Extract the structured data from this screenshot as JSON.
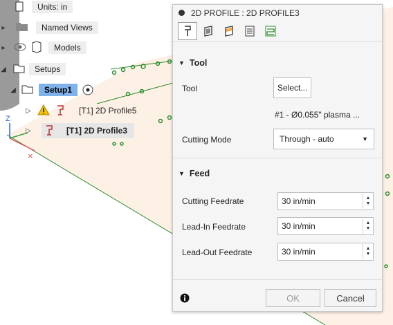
{
  "browser": {
    "units_label": "Units: in",
    "named_views_label": "Named Views",
    "models_label": "Models",
    "setups_label": "Setups",
    "setup1_label": "Setup1",
    "op1_label": "[T1] 2D Profile5",
    "op2_label": "[T1] 2D Profile3"
  },
  "axis": {
    "z": "Z"
  },
  "dialog": {
    "title": "2D PROFILE : 2D PROFILE3",
    "tabs": [
      "tool-tab",
      "geometry-tab",
      "heights-tab",
      "passes-tab",
      "linking-tab"
    ],
    "tool_section": {
      "heading": "Tool",
      "tool_label": "Tool",
      "select_button": "Select...",
      "tool_desc": "#1 - Ø0.055\" plasma ...",
      "cutting_mode_label": "Cutting Mode",
      "cutting_mode_value": "Through - auto"
    },
    "feed_section": {
      "heading": "Feed",
      "cutting_feedrate_label": "Cutting Feedrate",
      "cutting_feedrate_value": "30 in/min",
      "leadin_feedrate_label": "Lead-In Feedrate",
      "leadin_feedrate_value": "30 in/min",
      "leadout_feedrate_label": "Lead-Out Feedrate",
      "leadout_feedrate_value": "30 in/min"
    },
    "footer": {
      "ok": "OK",
      "cancel": "Cancel"
    }
  },
  "colors": {
    "accent": "#7fb2ea",
    "canvas_fill": "#fdf1e6",
    "path_green": "#2a8a2a",
    "warning": "#f2c200"
  }
}
